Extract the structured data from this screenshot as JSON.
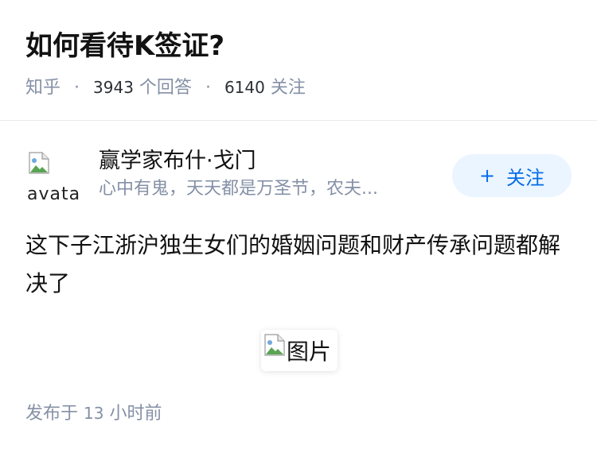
{
  "question": {
    "title": "如何看待K签证?",
    "source": "知乎",
    "answer_count": "3943",
    "answer_label": "个回答",
    "follower_count": "6140",
    "follower_label": "关注",
    "separator": "·"
  },
  "author": {
    "name": "赢学家布什·戈门",
    "bio": "心中有鬼，天天都是万圣节，农夫...",
    "avatar_alt": "avatar",
    "follow_plus": "+",
    "follow_label": "关注"
  },
  "answer": {
    "content": "这下子江浙沪独生女们的婚姻问题和财产传承问题都解决了",
    "image_alt": "图片",
    "publish_prefix": "发布于",
    "publish_number": "13",
    "publish_suffix": "小时前"
  },
  "colors": {
    "accent": "#056de8",
    "follow_bg": "#ebf5ff",
    "meta_gray": "#8590a6"
  }
}
